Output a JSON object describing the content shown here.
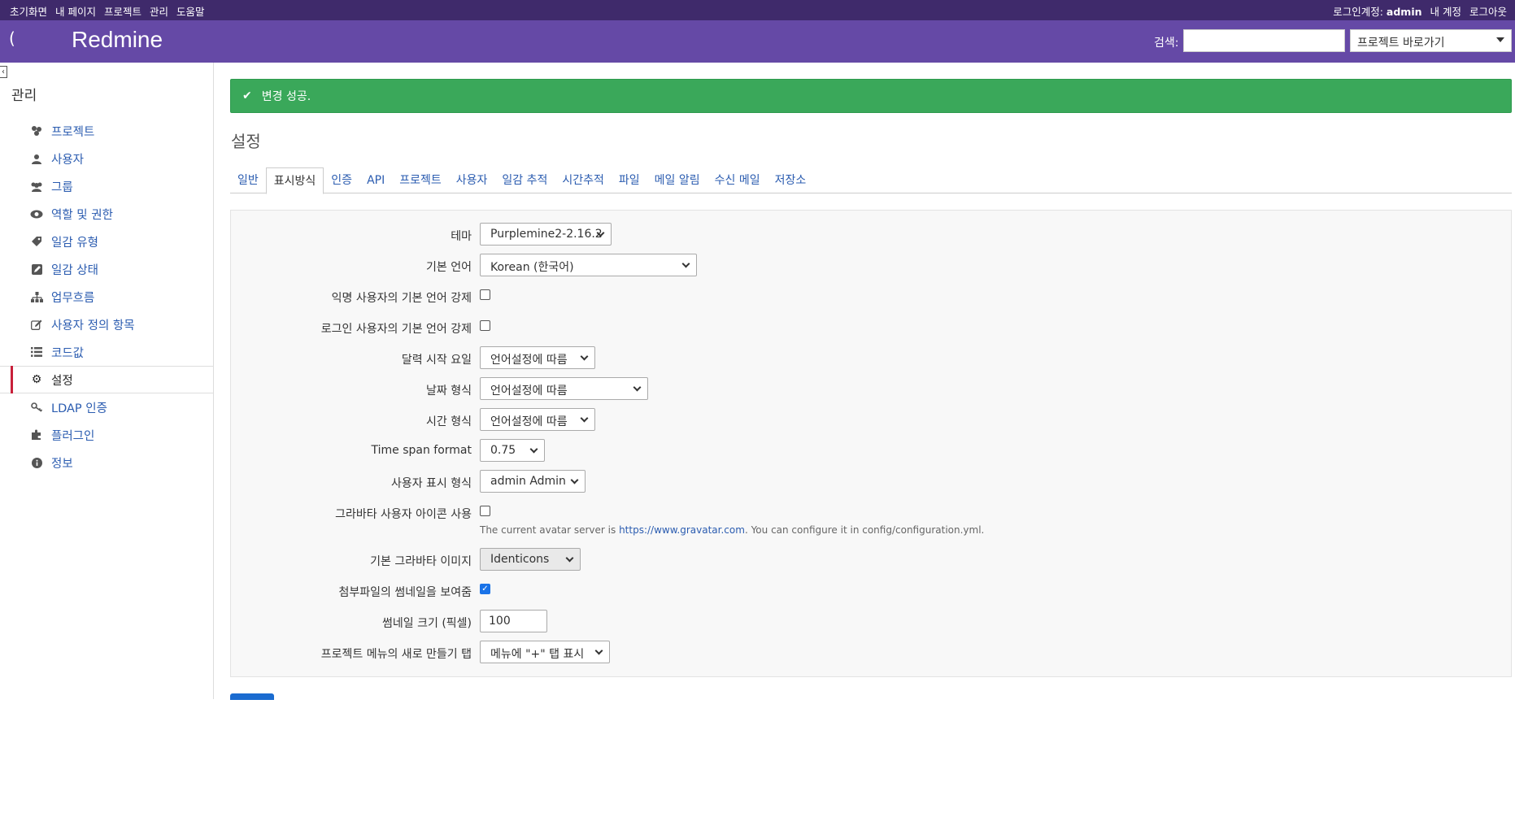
{
  "top_menu": {
    "left": [
      "초기화면",
      "내 페이지",
      "프로젝트",
      "관리",
      "도움말"
    ],
    "login_prefix": "로그인계정:",
    "login_user": "admin",
    "my_account": "내 계정",
    "logout": "로그아웃"
  },
  "header": {
    "title": "Redmine",
    "search_label": "검색:",
    "search_value": "",
    "project_jump": "프로젝트 바로가기"
  },
  "sidebar": {
    "title": "관리",
    "items": [
      {
        "label": "프로젝트",
        "icon": "projects-icon"
      },
      {
        "label": "사용자",
        "icon": "user-icon"
      },
      {
        "label": "그룹",
        "icon": "group-icon"
      },
      {
        "label": "역할 및 권한",
        "icon": "eye-icon"
      },
      {
        "label": "일감 유형",
        "icon": "tag-icon"
      },
      {
        "label": "일감 상태",
        "icon": "edit-square-icon"
      },
      {
        "label": "업무흐름",
        "icon": "sitemap-icon"
      },
      {
        "label": "사용자 정의 항목",
        "icon": "pencil-icon"
      },
      {
        "label": "코드값",
        "icon": "list-icon"
      },
      {
        "label": "설정",
        "icon": "gear-icon",
        "selected": true
      },
      {
        "label": "LDAP 인증",
        "icon": "key-icon"
      },
      {
        "label": "플러그인",
        "icon": "puzzle-icon"
      },
      {
        "label": "정보",
        "icon": "info-icon"
      }
    ]
  },
  "flash": "변경 성공.",
  "page_title": "설정",
  "tabs": [
    "일반",
    "표시방식",
    "인증",
    "API",
    "프로젝트",
    "사용자",
    "일감 추적",
    "시간추적",
    "파일",
    "메일 알림",
    "수신 메일",
    "저장소"
  ],
  "active_tab": "표시방식",
  "settings": {
    "theme": {
      "label": "테마",
      "value": "Purplemine2-2.16.2"
    },
    "default_language": {
      "label": "기본 언어",
      "value": "Korean (한국어)"
    },
    "force_anon_lang": {
      "label": "익명 사용자의 기본 언어 강제",
      "checked": false
    },
    "force_login_lang": {
      "label": "로그인 사용자의 기본 언어 강제",
      "checked": false
    },
    "start_of_week": {
      "label": "달력 시작 요일",
      "value": "언어설정에 따름"
    },
    "date_format": {
      "label": "날짜 형식",
      "value": "언어설정에 따름"
    },
    "time_format": {
      "label": "시간 형식",
      "value": "언어설정에 따름"
    },
    "timespan_format": {
      "label": "Time span format",
      "value": "0.75"
    },
    "user_format": {
      "label": "사용자 표시 형식",
      "value": "admin Admin"
    },
    "gravatar": {
      "label": "그라바타 사용자 아이콘 사용",
      "checked": false
    },
    "gravatar_info_prefix": "The current avatar server is ",
    "gravatar_info_link": "https://www.gravatar.com",
    "gravatar_info_suffix": ". You can configure it in config/configuration.yml.",
    "default_gravatar": {
      "label": "기본 그라바타 이미지",
      "value": "Identicons"
    },
    "thumbnails": {
      "label": "첨부파일의 썸네일을 보여줌",
      "checked": true
    },
    "thumbnail_size": {
      "label": "썸네일 크기 (픽셀)",
      "value": "100"
    },
    "new_item_tab": {
      "label": "프로젝트 메뉴의 새로 만들기 탭",
      "value": "메뉴에 \"+\" 탭 표시"
    }
  }
}
